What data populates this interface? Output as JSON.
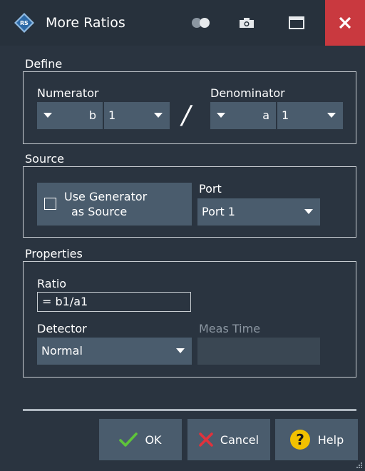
{
  "window": {
    "title": "More Ratios"
  },
  "define": {
    "group_label": "Define",
    "numerator": {
      "label": "Numerator",
      "wave": "b",
      "port": "1"
    },
    "slash": "/",
    "denominator": {
      "label": "Denominator",
      "wave": "a",
      "port": "1"
    }
  },
  "source": {
    "group_label": "Source",
    "use_generator_label_line1": "Use Generator",
    "use_generator_label_line2": "as Source",
    "use_generator_checked": false,
    "port_label": "Port",
    "port_value": "Port 1"
  },
  "properties": {
    "group_label": "Properties",
    "ratio_label": "Ratio",
    "ratio_value": "= b1/a1",
    "detector_label": "Detector",
    "detector_value": "Normal",
    "meas_time_label": "Meas Time"
  },
  "buttons": {
    "ok": "OK",
    "cancel": "Cancel",
    "help": "Help"
  },
  "colors": {
    "accent": "#4a5c6d",
    "close": "#c9393f",
    "ok_check": "#5ec43a",
    "cancel_x": "#e0323c",
    "help": "#f2c200"
  }
}
